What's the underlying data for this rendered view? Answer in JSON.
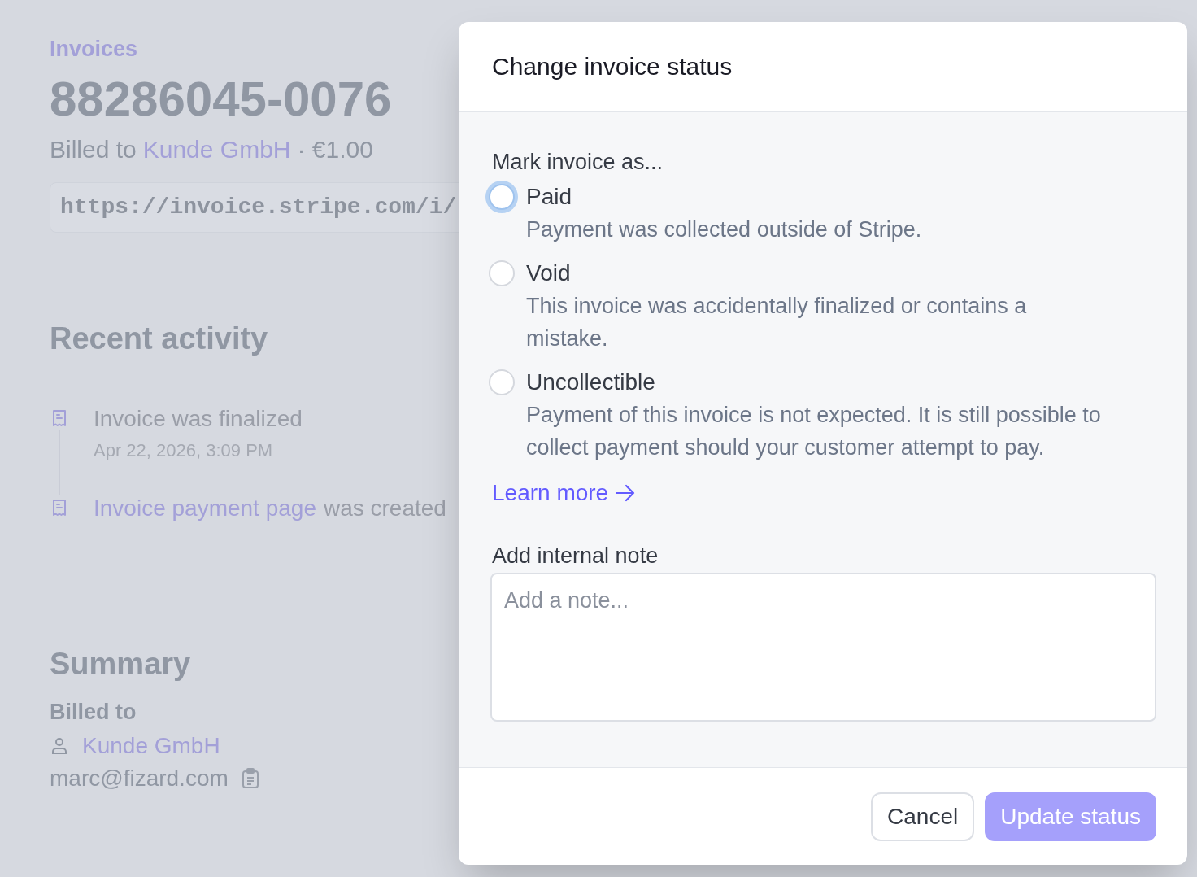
{
  "page": {
    "breadcrumb": "Invoices",
    "invoice_number": "88286045-0076",
    "billed_line": {
      "prefix": "Billed to",
      "customer": "Kunde GmbH",
      "amount": "· €1.00"
    },
    "url": "https://invoice.stripe.com/i/"
  },
  "recent_activity": {
    "title": "Recent activity",
    "items": [
      {
        "text": "Invoice was finalized",
        "time": "Apr 22, 2026, 3:09 PM"
      },
      {
        "link": "Invoice payment page",
        "text": "was created"
      }
    ]
  },
  "summary": {
    "title": "Summary",
    "billed_to_label": "Billed to",
    "customer": "Kunde GmbH",
    "email": "marc@fizard.com"
  },
  "dialog": {
    "title": "Change invoice status",
    "prompt": "Mark invoice as...",
    "options": [
      {
        "label": "Paid",
        "description": "Payment was collected outside of Stripe.",
        "selected": false,
        "focused": true
      },
      {
        "label": "Void",
        "description": "This invoice was accidentally finalized or contains a mistake.",
        "selected": false,
        "focused": false
      },
      {
        "label": "Uncollectible",
        "description": "Payment of this invoice is not expected. It is still possible to collect payment should your customer attempt to pay.",
        "selected": false,
        "focused": false
      }
    ],
    "learn_more": "Learn more",
    "note_label": "Add internal note",
    "note_placeholder": "Add a note...",
    "buttons": [
      {
        "label": "Cancel",
        "kind": "secondary"
      },
      {
        "label": "Update status",
        "kind": "primary"
      }
    ]
  }
}
